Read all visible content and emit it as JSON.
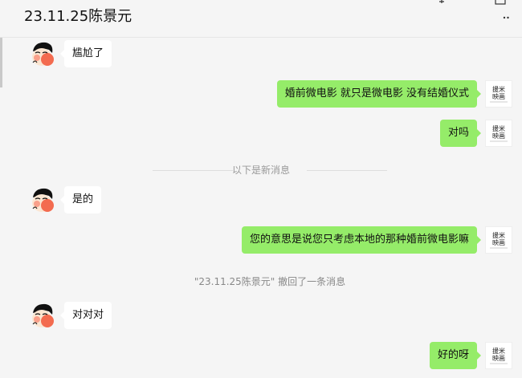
{
  "header": {
    "title": "23.11.25陈景元"
  },
  "colors": {
    "sent_bubble": "#95ec69",
    "received_bubble": "#ffffff",
    "background": "#f5f5f5"
  },
  "contact_avatar": {
    "icon": "cartoon-avatar-icon"
  },
  "self_avatar": {
    "icon": "brand-logo-icon",
    "text_line1": "援米",
    "text_line2": "映画"
  },
  "messages": [
    {
      "side": "left",
      "text": "尴尬了"
    },
    {
      "side": "right",
      "text": "婚前微电影 就只是微电影 没有结婚仪式"
    },
    {
      "side": "right",
      "text": "对吗"
    },
    {
      "side": "left",
      "text": "是的"
    },
    {
      "side": "right",
      "text": "您的意思是说您只考虑本地的那种婚前微电影嘛"
    },
    {
      "side": "left",
      "text": "对对对"
    },
    {
      "side": "right",
      "text": "好的呀"
    }
  ],
  "divider": {
    "text": "以下是新消息"
  },
  "system_notice": {
    "text": "\"23.11.25陈景元\" 撤回了一条消息"
  }
}
